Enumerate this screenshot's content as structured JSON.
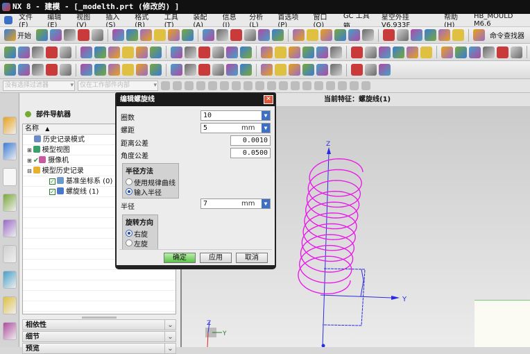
{
  "window": {
    "title": "NX 8 - 建模 - [_modelth.prt  (修改的) ]"
  },
  "menu": [
    "文件(F)",
    "编辑(E)",
    "视图(V)",
    "插入(S)",
    "格式(R)",
    "工具(T)",
    "装配(A)",
    "信息(I)",
    "分析(L)",
    "首选项(P)",
    "窗口(O)",
    "GC 工具箱",
    "星空外挂 V6.933F",
    "帮助(H)",
    "HB_MOULD M6.6"
  ],
  "toolbar": {
    "start_label": "开始",
    "command_finder_label": "命令查找器"
  },
  "selection_bar": {
    "filter": "没有选择过滤器",
    "scope": "仅在工作部件内部"
  },
  "navigator": {
    "title": "部件导航器",
    "column_name": "名称",
    "items": [
      {
        "label": "历史记录模式",
        "indent": 0,
        "icon": "clock-icon"
      },
      {
        "label": "模型视图",
        "indent": 0,
        "icon": "model-view-icon",
        "expander": "+"
      },
      {
        "label": "摄像机",
        "indent": 0,
        "icon": "camera-icon",
        "expander": "+"
      },
      {
        "label": "模型历史记录",
        "indent": 0,
        "icon": "folder-icon",
        "expander": "-"
      },
      {
        "label": "基准坐标系 (0)",
        "indent": 1,
        "icon": "datum-csys-icon",
        "checked": true
      },
      {
        "label": "螺旋线 (1)",
        "indent": 1,
        "icon": "helix-icon",
        "checked": true
      }
    ],
    "sections": [
      "相依性",
      "细节",
      "预览"
    ]
  },
  "viewport": {
    "current_feature": "当前特征：螺旋线(1)",
    "axis_y": "Y",
    "axis_z": "Z",
    "helix_color": "#e81ee8",
    "csys_color": "#2a2ae0",
    "turns": 10
  },
  "dialog": {
    "title": "编辑螺旋线",
    "turns_label": "圈数",
    "turns_value": "10",
    "pitch_label": "螺距",
    "pitch_value": "5",
    "pitch_unit": "mm",
    "dist_tol_label": "距离公差",
    "dist_tol_value": "0.0010",
    "angle_tol_label": "角度公差",
    "angle_tol_value": "0.0500",
    "radius_method": {
      "title": "半径方法",
      "options": [
        "使用规律曲线",
        "输入半径"
      ],
      "selected": 1
    },
    "radius_label": "半径",
    "radius_value": "7",
    "radius_unit": "mm",
    "direction": {
      "title": "旋转方向",
      "options": [
        "右旋",
        "左旋"
      ],
      "selected": 0
    },
    "ok": "确定",
    "apply": "应用",
    "cancel": "取消"
  }
}
